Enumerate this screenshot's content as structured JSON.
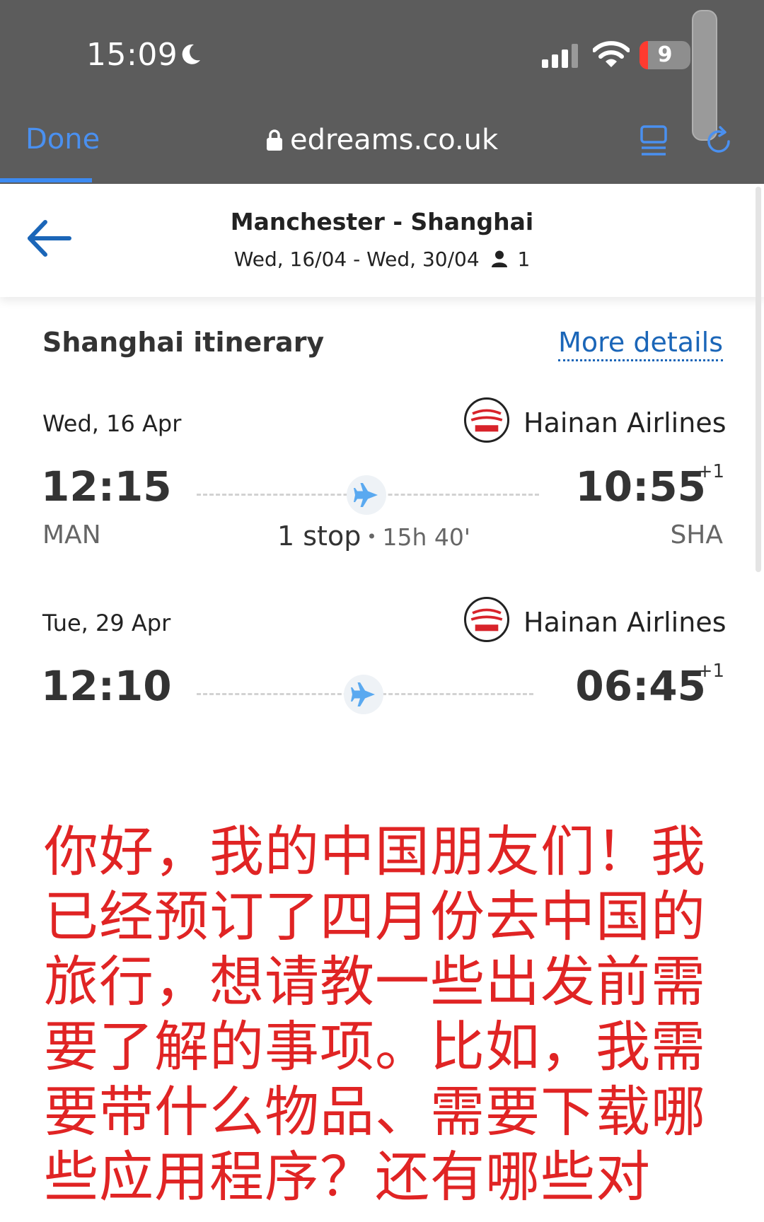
{
  "status_bar": {
    "time": "15:09",
    "battery": "9",
    "icons": [
      "moon-icon",
      "signal-icon",
      "wifi-icon",
      "battery-icon"
    ]
  },
  "browser": {
    "done_label": "Done",
    "url": "edreams.co.uk",
    "icons": [
      "lock-icon",
      "reader-icon",
      "reload-icon"
    ]
  },
  "header": {
    "title": "Manchester - Shanghai",
    "dates": "Wed, 16/04 - Wed, 30/04",
    "passengers": "1"
  },
  "itinerary": {
    "title": "Shanghai itinerary",
    "more_details": "More details",
    "legs": [
      {
        "date": "Wed, 16 Apr",
        "airline": "Hainan Airlines",
        "departure_time": "12:15",
        "arrival_time": "10:55",
        "day_offset": "+1",
        "from": "MAN",
        "to": "SHA",
        "stops": "1 stop",
        "duration": "15h 40'"
      },
      {
        "date": "Tue, 29 Apr",
        "airline": "Hainan Airlines",
        "departure_time": "12:10",
        "arrival_time": "06:45",
        "day_offset": "+1"
      }
    ]
  },
  "caption": "你好，我的中国朋友们！我已经预订了四月份去中国的旅行，想请教一些出发前需要了解的事项。比如，我需要带什么物品、需要下载哪些应用程序？还有哪些对",
  "colors": {
    "chrome_bg": "#5c5c5c",
    "link_blue": "#1b66b8",
    "ios_blue": "#4a90f0",
    "caption_red": "#e02424",
    "plane_blue": "#5aa9f0"
  }
}
